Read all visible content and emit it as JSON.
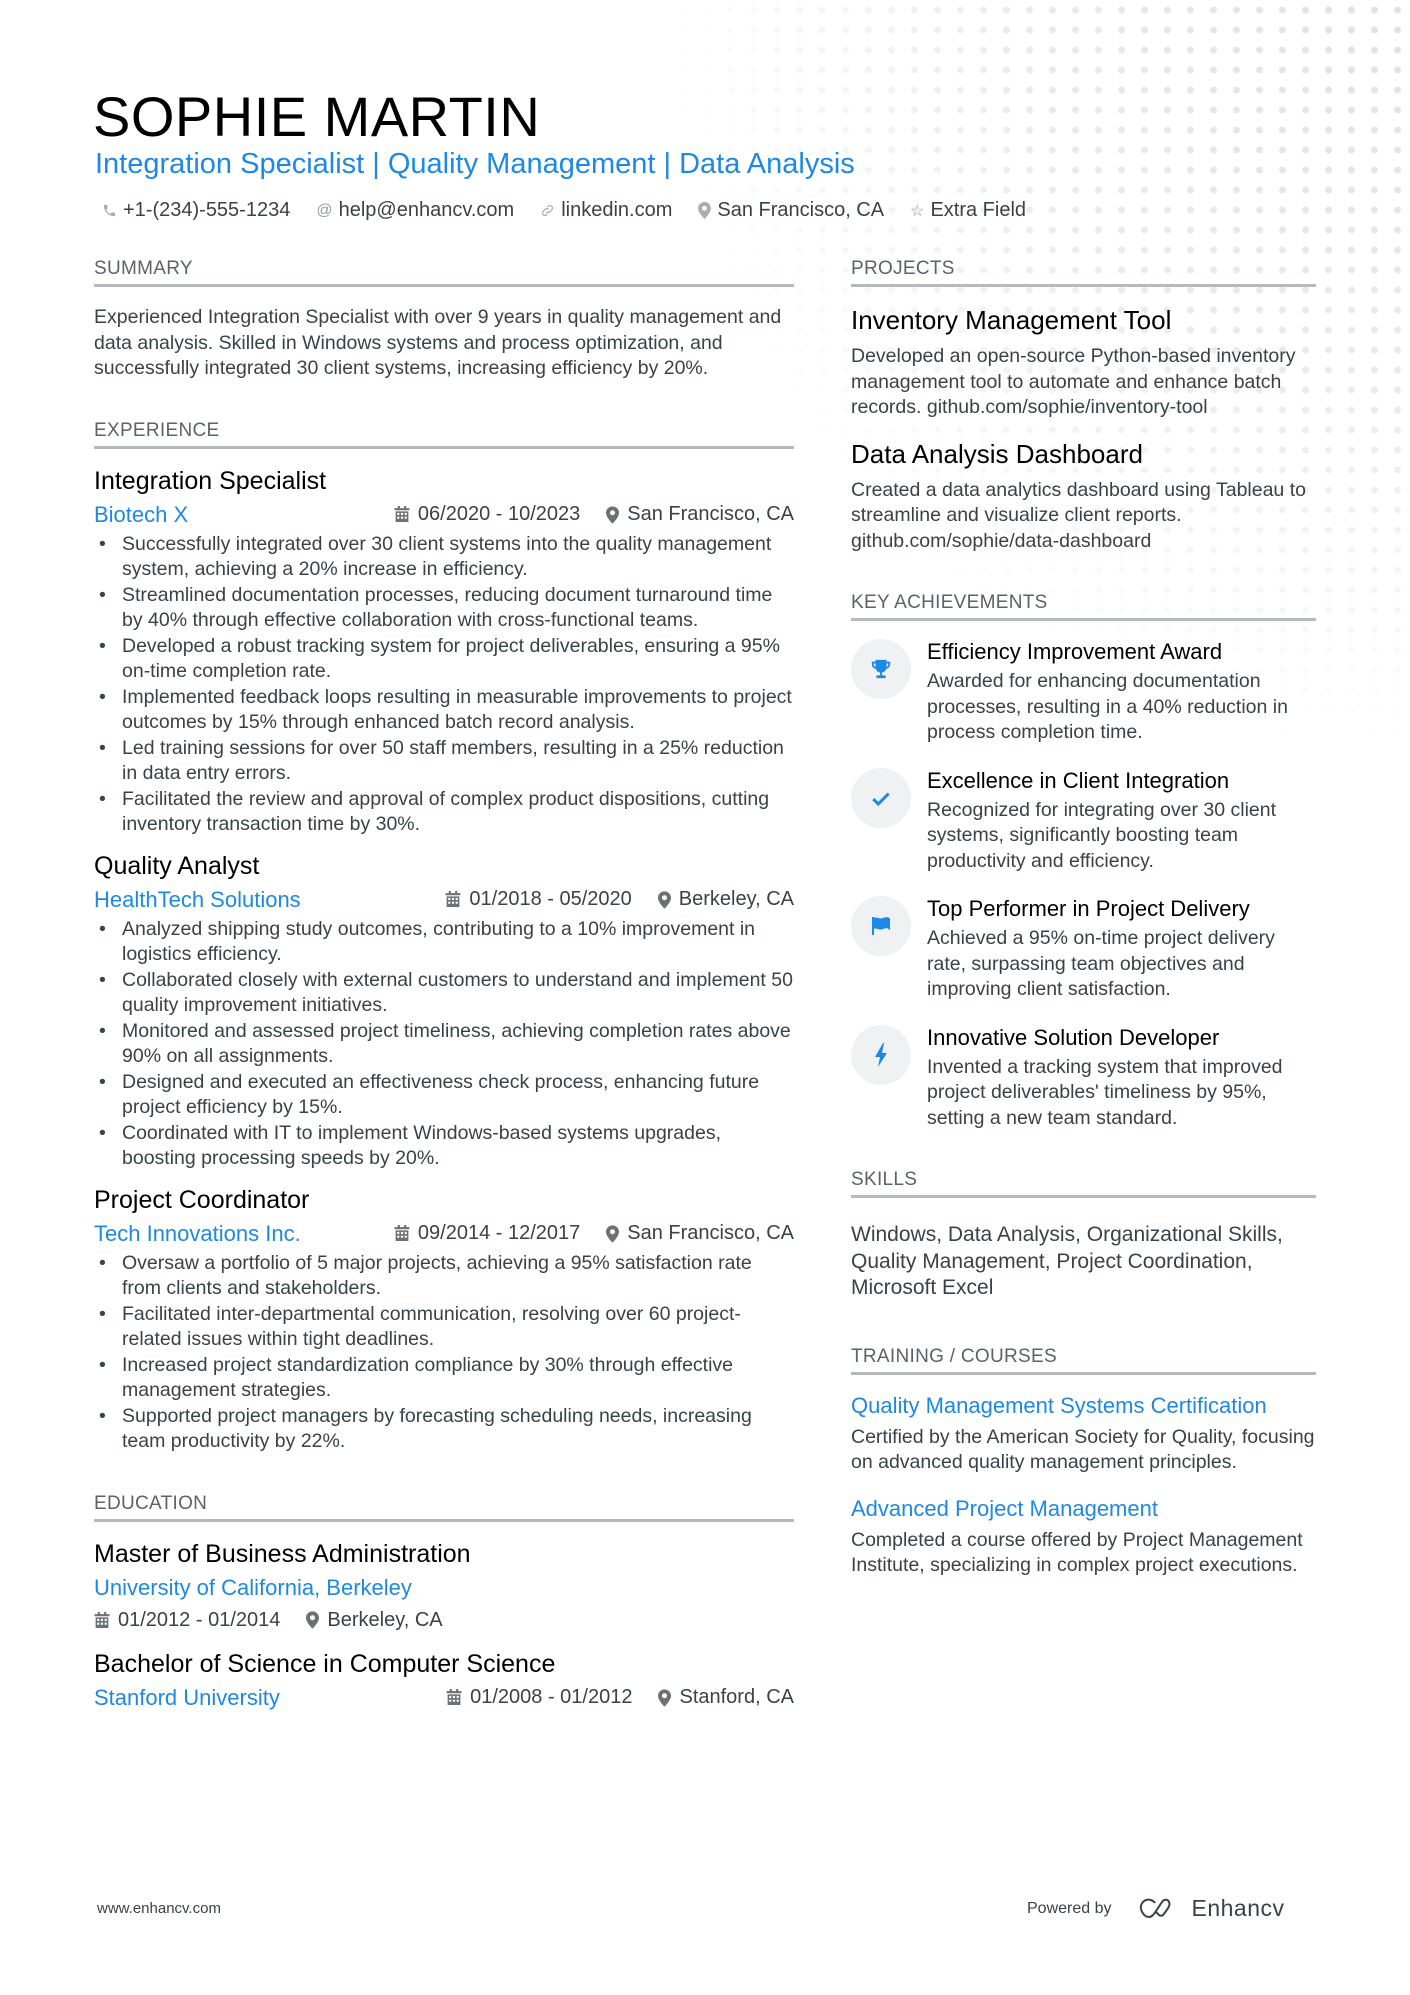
{
  "header": {
    "name": "SOPHIE MARTIN",
    "headline": "Integration Specialist | Quality Management | Data Analysis",
    "contacts": [
      {
        "icon": "phone-icon",
        "text": "+1-(234)-555-1234"
      },
      {
        "icon": "at-icon",
        "text": "help@enhancv.com"
      },
      {
        "icon": "link-icon",
        "text": "linkedin.com"
      },
      {
        "icon": "location-icon",
        "text": "San Francisco, CA"
      },
      {
        "icon": "star-icon",
        "text": "Extra Field"
      }
    ]
  },
  "summary": {
    "title": "SUMMARY",
    "text": "Experienced Integration Specialist with over 9 years in quality management and data analysis. Skilled in Windows systems and process optimization, and successfully integrated 30 client systems, increasing efficiency by 20%."
  },
  "experience": {
    "title": "EXPERIENCE",
    "jobs": [
      {
        "title": "Integration Specialist",
        "company": "Biotech X",
        "dates": "06/2020 - 10/2023",
        "location": "San Francisco, CA",
        "bullets": [
          "Successfully integrated over 30 client systems into the quality management system, achieving a 20% increase in efficiency.",
          "Streamlined documentation processes, reducing document turnaround time by 40% through effective collaboration with cross-functional teams.",
          "Developed a robust tracking system for project deliverables, ensuring a 95% on-time completion rate.",
          "Implemented feedback loops resulting in measurable improvements to project outcomes by 15% through enhanced batch record analysis.",
          "Led training sessions for over 50 staff members, resulting in a 25% reduction in data entry errors.",
          "Facilitated the review and approval of complex product dispositions, cutting inventory transaction time by 30%."
        ]
      },
      {
        "title": "Quality Analyst",
        "company": "HealthTech Solutions",
        "dates": "01/2018 - 05/2020",
        "location": "Berkeley, CA",
        "bullets": [
          "Analyzed shipping study outcomes, contributing to a 10% improvement in logistics efficiency.",
          "Collaborated closely with external customers to understand and implement 50 quality improvement initiatives.",
          "Monitored and assessed project timeliness, achieving completion rates above 90% on all assignments.",
          "Designed and executed an effectiveness check process, enhancing future project efficiency by 15%.",
          "Coordinated with IT to implement Windows-based systems upgrades, boosting processing speeds by 20%."
        ]
      },
      {
        "title": "Project Coordinator",
        "company": "Tech Innovations Inc.",
        "dates": "09/2014 - 12/2017",
        "location": "San Francisco, CA",
        "bullets": [
          "Oversaw a portfolio of 5 major projects, achieving a 95% satisfaction rate from clients and stakeholders.",
          "Facilitated inter-departmental communication, resolving over 60 project-related issues within tight deadlines.",
          "Increased project standardization compliance by 30% through effective management strategies.",
          "Supported project managers by forecasting scheduling needs, increasing team productivity by 22%."
        ]
      }
    ]
  },
  "education": {
    "title": "EDUCATION",
    "items": [
      {
        "degree": "Master of Business Administration",
        "school": "University of California, Berkeley",
        "dates": "01/2012 - 01/2014",
        "location": "Berkeley, CA"
      },
      {
        "degree": "Bachelor of Science in Computer Science",
        "school": "Stanford University",
        "dates": "01/2008 - 01/2012",
        "location": "Stanford, CA"
      }
    ]
  },
  "projects": {
    "title": "PROJECTS",
    "items": [
      {
        "title": "Inventory Management Tool",
        "desc": "Developed an open-source Python-based inventory management tool to automate and enhance batch records. github.com/sophie/inventory-tool"
      },
      {
        "title": "Data Analysis Dashboard",
        "desc": "Created a data analytics dashboard using Tableau to streamline and visualize client reports. github.com/sophie/data-dashboard"
      }
    ]
  },
  "achievements": {
    "title": "KEY ACHIEVEMENTS",
    "items": [
      {
        "icon": "trophy-icon",
        "title": "Efficiency Improvement Award",
        "desc": "Awarded for enhancing documentation processes, resulting in a 40% reduction in process completion time."
      },
      {
        "icon": "checkmark-icon",
        "title": "Excellence in Client Integration",
        "desc": "Recognized for integrating over 30 client systems, significantly boosting team productivity and efficiency."
      },
      {
        "icon": "flag-icon",
        "title": "Top Performer in Project Delivery",
        "desc": "Achieved a 95% on-time project delivery rate, surpassing team objectives and improving client satisfaction."
      },
      {
        "icon": "lightning-icon",
        "title": "Innovative Solution Developer",
        "desc": "Invented a tracking system that improved project deliverables' timeliness by 95%, setting a new team standard."
      }
    ]
  },
  "skills": {
    "title": "SKILLS",
    "text": "Windows, Data Analysis, Organizational Skills, Quality Management, Project Coordination, Microsoft Excel"
  },
  "training": {
    "title": "TRAINING / COURSES",
    "items": [
      {
        "title": "Quality Management Systems Certification",
        "desc": "Certified by the American Society for Quality, focusing on advanced quality management principles."
      },
      {
        "title": "Advanced Project Management",
        "desc": "Completed a course offered by Project Management Institute, specializing in complex project executions."
      }
    ]
  },
  "footer": {
    "website": "www.enhancv.com",
    "powered_by": "Powered by",
    "brand": "Enhancv"
  },
  "colors": {
    "accent": "#1e88e5",
    "text": "#384347",
    "heading": "#000000",
    "rule": "#b6babc"
  }
}
